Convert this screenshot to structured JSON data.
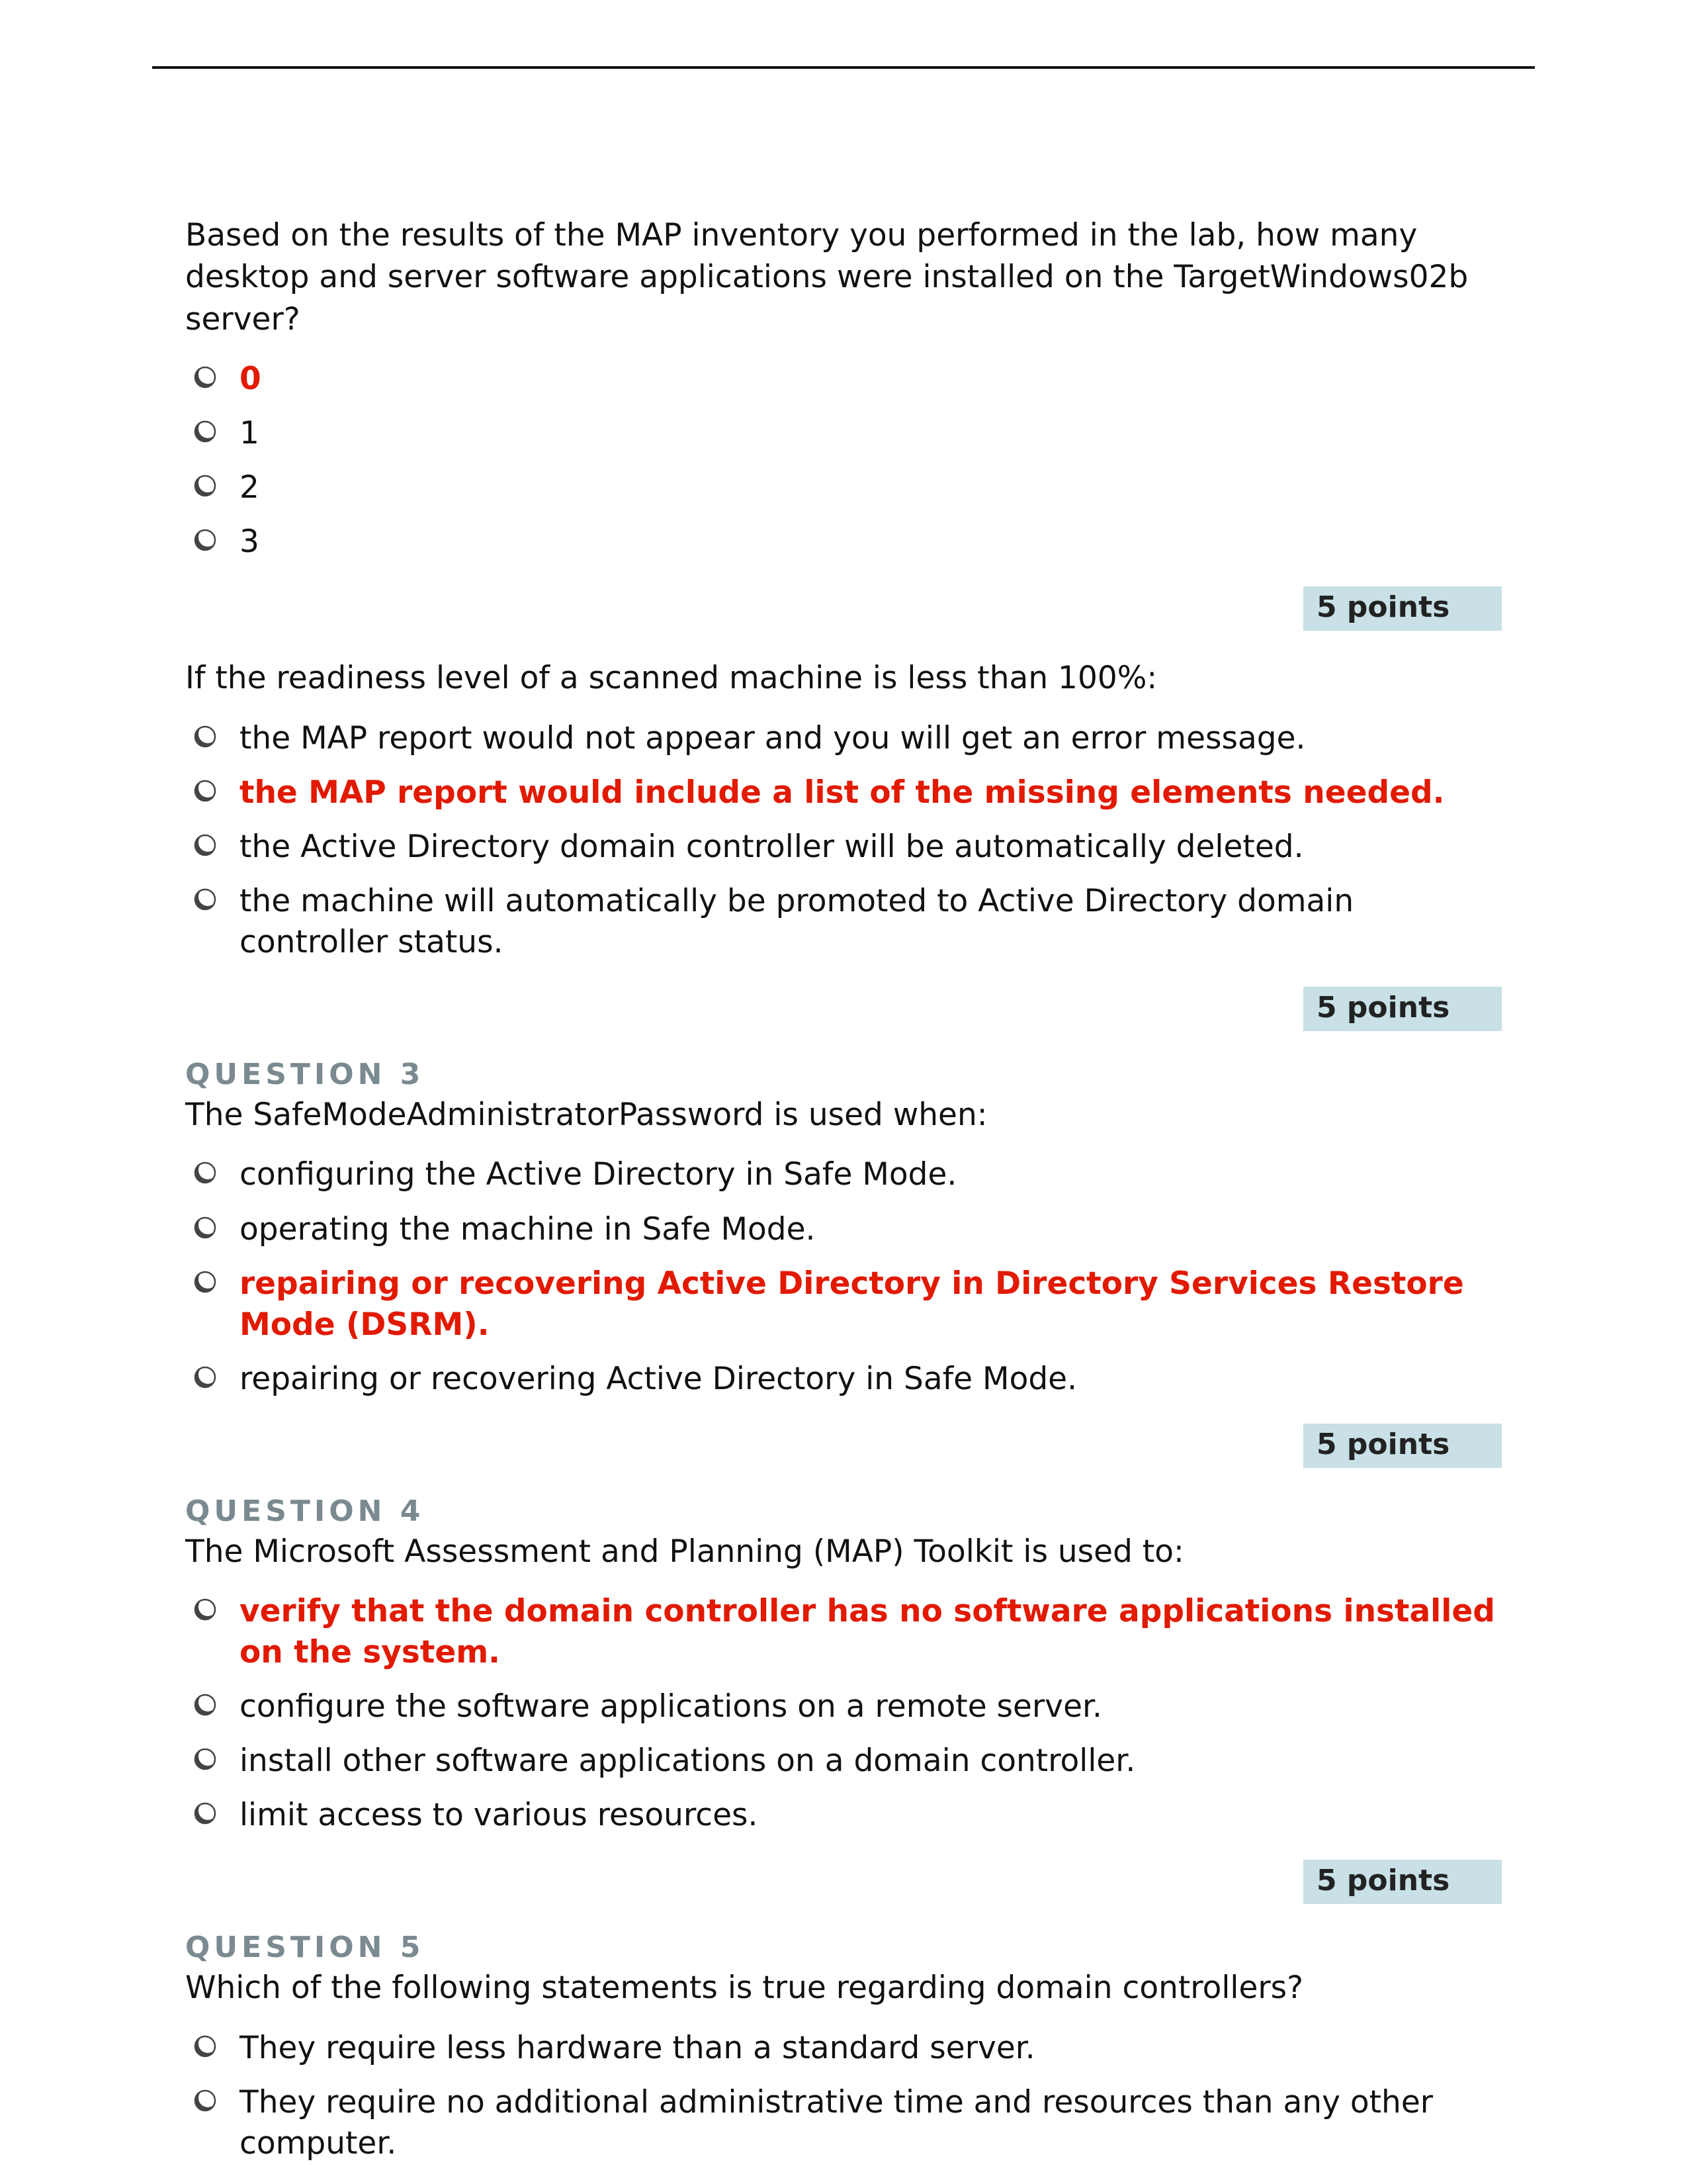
{
  "points_text": "5 points",
  "colors": {
    "answer": "#e11a00",
    "badge_bg": "#c8e0e6",
    "label_gray": "#7a8a90"
  },
  "questions": [
    {
      "label": "",
      "text": "Based on the results of the MAP inventory you performed in the lab, how many desktop and server software applications were installed on the TargetWindows02b server?",
      "options": [
        {
          "text": "0",
          "answer": true
        },
        {
          "text": "1",
          "answer": false
        },
        {
          "text": "2",
          "answer": false
        },
        {
          "text": "3",
          "answer": false
        }
      ],
      "show_points": true
    },
    {
      "label": "",
      "text": "If the readiness level of a scanned machine is less than 100%:",
      "options": [
        {
          "text": "the MAP report would not appear and you will get an error message.",
          "answer": false
        },
        {
          "text": "the MAP report would include a list of the missing elements needed.",
          "answer": true
        },
        {
          "text": "the Active Directory domain controller will be automatically deleted.",
          "answer": false
        },
        {
          "text": "the machine will automatically be promoted to Active Directory domain controller status.",
          "answer": false
        }
      ],
      "show_points": true
    },
    {
      "label": "QUESTION 3",
      "text": "The SafeModeAdministratorPassword is used when:",
      "options": [
        {
          "text": "configuring the Active Directory in Safe Mode.",
          "answer": false
        },
        {
          "text": "operating the machine in Safe Mode.",
          "answer": false
        },
        {
          "text": "repairing or recovering Active Directory in Directory Services Restore Mode (DSRM).",
          "answer": true
        },
        {
          "text": "repairing or recovering Active Directory in Safe Mode.",
          "answer": false
        }
      ],
      "show_points": true
    },
    {
      "label": "QUESTION 4",
      "text": "The Microsoft Assessment and Planning (MAP) Toolkit is used to:",
      "options": [
        {
          "text": "verify that the domain controller has no software applications installed on the system.",
          "answer": true
        },
        {
          "text": "configure the software applications on a remote server.",
          "answer": false
        },
        {
          "text": "install other software applications on a domain controller.",
          "answer": false
        },
        {
          "text": "limit access to various resources.",
          "answer": false
        }
      ],
      "show_points": true
    },
    {
      "label": "QUESTION 5",
      "text": "Which of the following statements is true regarding domain controllers?",
      "options": [
        {
          "text": "They require less hardware than a standard server.",
          "answer": false
        },
        {
          "text": "They require no additional administrative time and resources than any other computer.",
          "answer": false
        }
      ],
      "show_points": false
    }
  ]
}
